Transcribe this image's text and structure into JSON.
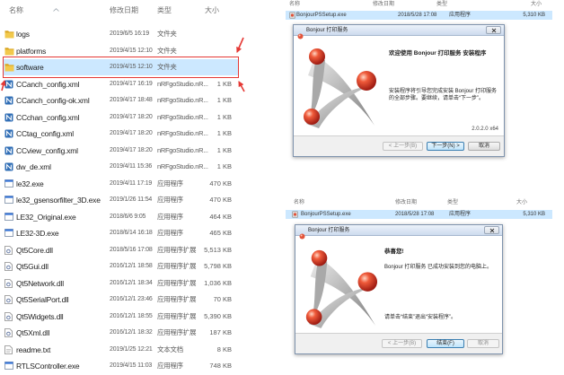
{
  "explorer": {
    "columns": {
      "name": "名称",
      "date": "修改日期",
      "type": "类型",
      "size": "大小"
    },
    "colors": {
      "selection": "#cce8ff",
      "annotation": "#e53935",
      "folder": "#f2c94c"
    },
    "rows": [
      {
        "icon": "folder-icon",
        "name": "logs",
        "date": "2019/6/5 16:19",
        "type": "文件夹"
      },
      {
        "icon": "folder-icon",
        "name": "platforms",
        "date": "2019/4/15 12:10",
        "type": "文件夹"
      },
      {
        "icon": "folder-icon",
        "name": "software",
        "date": "2019/4/15 12:10",
        "type": "文件夹",
        "selected": true
      },
      {
        "icon": "nrfgo-xml-icon",
        "name": "CCanch_config.xml",
        "date": "2019/4/17 16:19",
        "type": "nRFgoStudio.nR...",
        "size": "1 KB"
      },
      {
        "icon": "nrfgo-xml-icon",
        "name": "CCanch_config-ok.xml",
        "date": "2019/4/17 18:48",
        "type": "nRFgoStudio.nR...",
        "size": "1 KB"
      },
      {
        "icon": "nrfgo-xml-icon",
        "name": "CCchan_config.xml",
        "date": "2019/4/17 18:20",
        "type": "nRFgoStudio.nR...",
        "size": "1 KB"
      },
      {
        "icon": "nrfgo-xml-icon",
        "name": "CCtag_config.xml",
        "date": "2019/4/17 18:20",
        "type": "nRFgoStudio.nR...",
        "size": "1 KB"
      },
      {
        "icon": "nrfgo-xml-icon",
        "name": "CCview_config.xml",
        "date": "2019/4/17 18:20",
        "type": "nRFgoStudio.nR...",
        "size": "1 KB"
      },
      {
        "icon": "nrfgo-xml-icon",
        "name": "dw_de.xml",
        "date": "2019/4/11 15:36",
        "type": "nRFgoStudio.nR...",
        "size": "1 KB"
      },
      {
        "icon": "exe-file-icon",
        "name": "le32.exe",
        "date": "2019/4/11 17:19",
        "type": "应用程序",
        "size": "470 KB"
      },
      {
        "icon": "exe-file-icon",
        "name": "le32_gsensorfilter_3D.exe",
        "date": "2019/1/26 11:54",
        "type": "应用程序",
        "size": "470 KB"
      },
      {
        "icon": "exe-file-icon",
        "name": "LE32_Original.exe",
        "date": "2018/6/6 9:05",
        "type": "应用程序",
        "size": "464 KB"
      },
      {
        "icon": "exe-file-icon",
        "name": "LE32-3D.exe",
        "date": "2018/6/14 16:18",
        "type": "应用程序",
        "size": "465 KB"
      },
      {
        "icon": "dll-file-icon",
        "name": "Qt5Core.dll",
        "date": "2018/5/16 17:08",
        "type": "应用程序扩展",
        "size": "5,513 KB"
      },
      {
        "icon": "dll-file-icon",
        "name": "Qt5Gui.dll",
        "date": "2016/12/1 18:58",
        "type": "应用程序扩展",
        "size": "5,798 KB"
      },
      {
        "icon": "dll-file-icon",
        "name": "Qt5Network.dll",
        "date": "2016/12/1 18:34",
        "type": "应用程序扩展",
        "size": "1,036 KB"
      },
      {
        "icon": "dll-file-icon",
        "name": "Qt5SerialPort.dll",
        "date": "2016/12/1 23:46",
        "type": "应用程序扩展",
        "size": "70 KB"
      },
      {
        "icon": "dll-file-icon",
        "name": "Qt5Widgets.dll",
        "date": "2016/12/1 18:55",
        "type": "应用程序扩展",
        "size": "5,390 KB"
      },
      {
        "icon": "dll-file-icon",
        "name": "Qt5Xml.dll",
        "date": "2016/12/1 18:32",
        "type": "应用程序扩展",
        "size": "187 KB"
      },
      {
        "icon": "txt-file-icon",
        "name": "readme.txt",
        "date": "2019/1/25 12:21",
        "type": "文本文档",
        "size": "8 KB"
      },
      {
        "icon": "exe-file-icon",
        "name": "RTLSController.exe",
        "date": "2019/4/15 11:03",
        "type": "应用程序",
        "size": "748 KB"
      }
    ]
  },
  "setup_welcome": {
    "file_list": {
      "columns": {
        "name": "名称",
        "date": "修改日期",
        "type": "类型",
        "size": "大小"
      },
      "row": {
        "icon": "installer-exe-icon",
        "name": "BonjourPSSetup.exe",
        "date": "2018/5/28 17:08",
        "type": "应用程序",
        "size": "5,310 KB"
      }
    },
    "dialog": {
      "title": "Bonjour 打印服务",
      "heading": "欢迎使用 Bonjour 打印服务 安装程序",
      "body": "安装程序将引导您完成安装 Bonjour 打印服务 的全部步骤。要继续，请单击“下一步”。",
      "version": "2.0.2.0 x64",
      "buttons": {
        "back": "< 上一步(B)",
        "next": "下一步(N) >",
        "cancel": "取消"
      }
    }
  },
  "setup_complete": {
    "file_list": {
      "columns": {
        "name": "名称",
        "date": "修改日期",
        "type": "类型",
        "size": "大小"
      },
      "row": {
        "icon": "installer-exe-icon",
        "name": "BonjourPSSetup.exe",
        "date": "2018/5/28 17:08",
        "type": "应用程序",
        "size": "5,310 KB"
      }
    },
    "dialog": {
      "title": "Bonjour 打印服务",
      "heading": "恭喜您!",
      "body": "Bonjour 打印服务 已成功安装到您的电脑上。",
      "instruction": "请单击“结束”退出“安装程序”。",
      "buttons": {
        "back": "< 上一步(B)",
        "finish": "结束(F)",
        "cancel": "取消"
      }
    }
  }
}
